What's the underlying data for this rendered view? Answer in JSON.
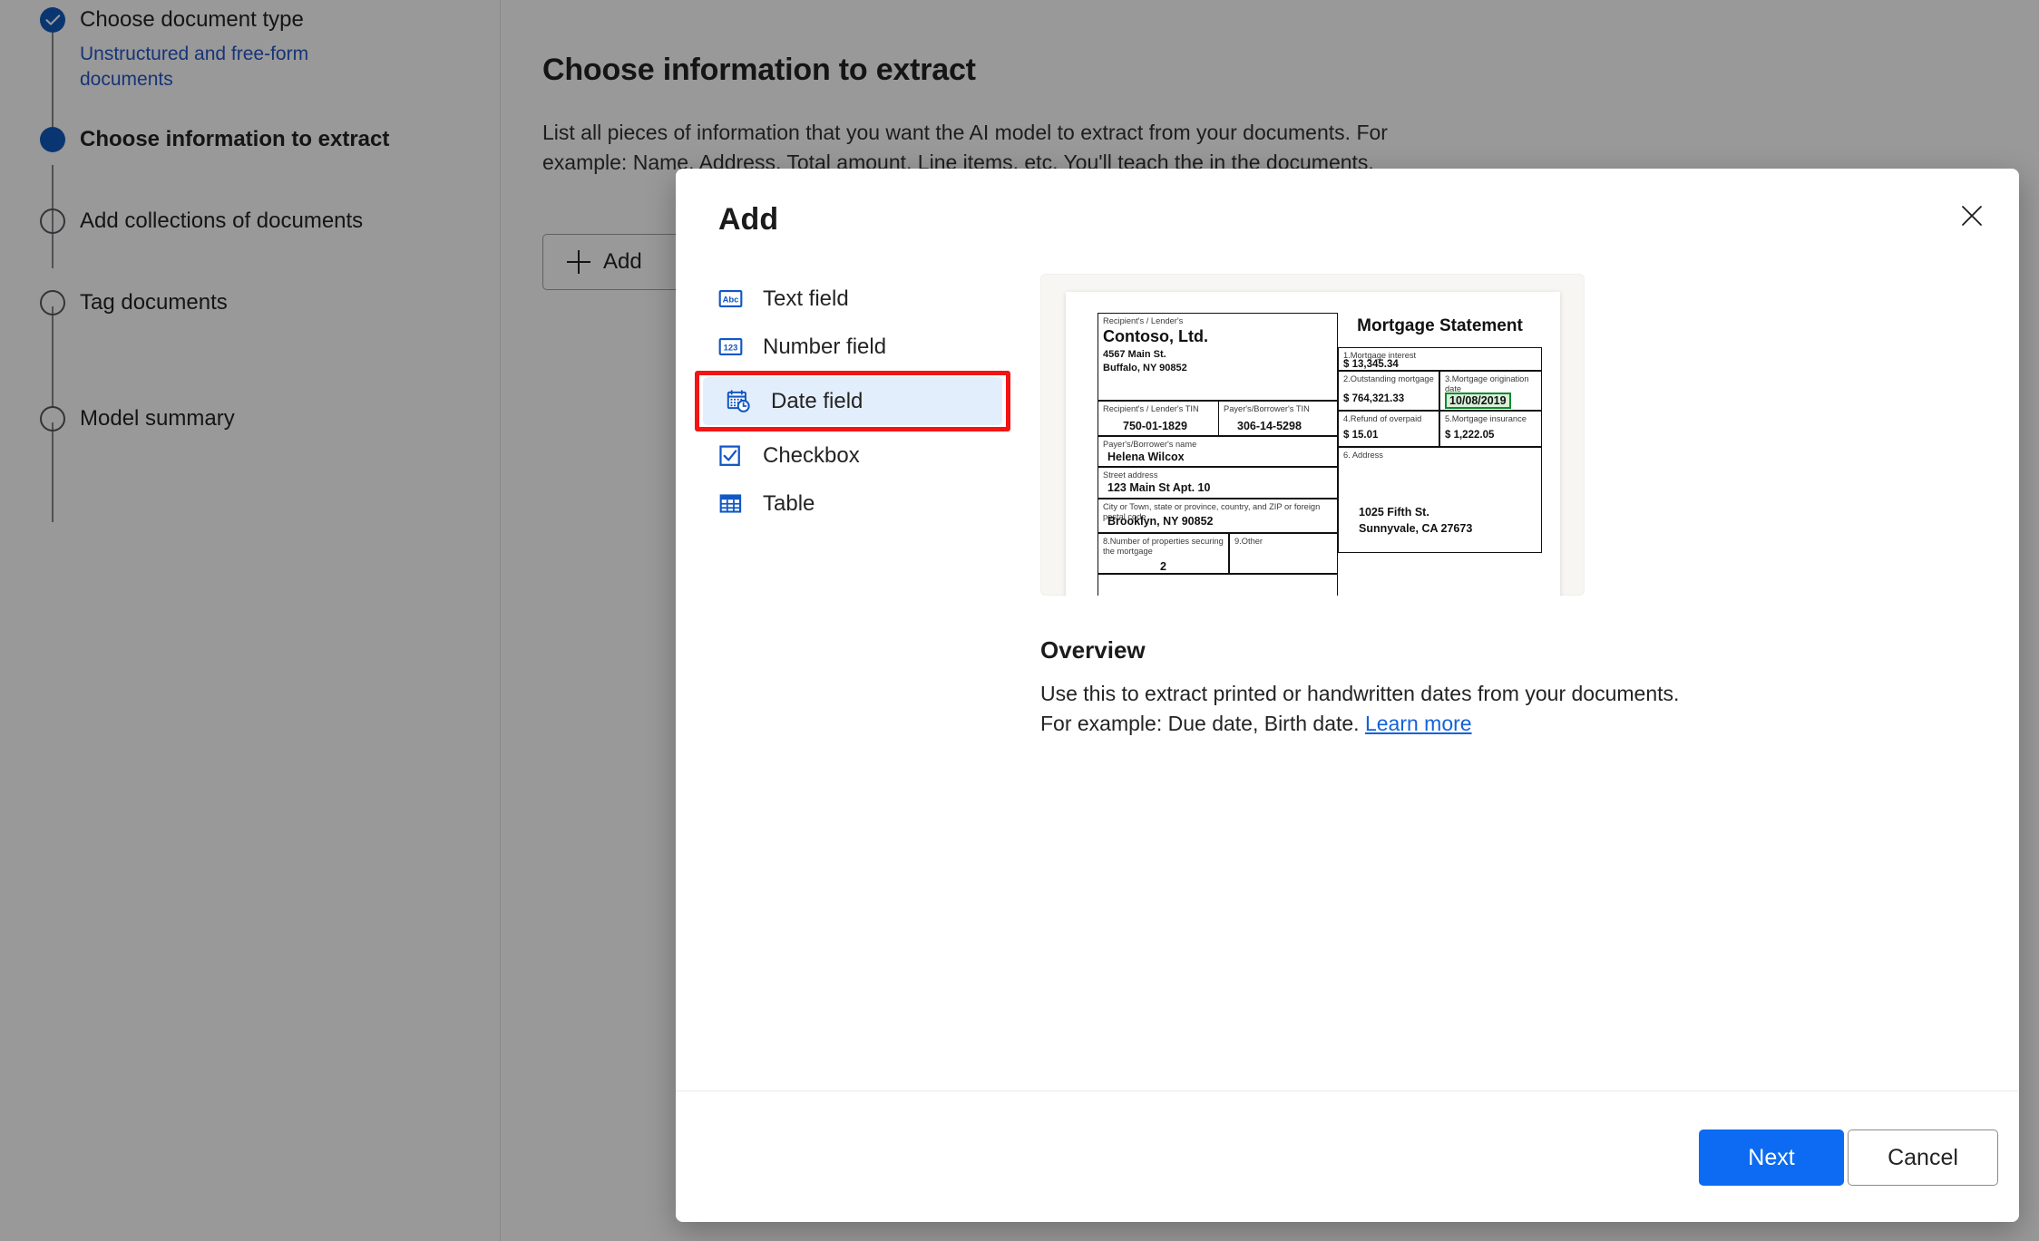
{
  "wizard": {
    "steps": [
      {
        "label": "Choose document type",
        "state": "done",
        "sublabel": "Unstructured and free-form documents"
      },
      {
        "label": "Choose information to extract",
        "state": "current",
        "sublabel": ""
      },
      {
        "label": "Add collections of documents",
        "state": "todo",
        "sublabel": ""
      },
      {
        "label": "Tag documents",
        "state": "todo",
        "sublabel": ""
      },
      {
        "label": "Model summary",
        "state": "todo",
        "sublabel": ""
      }
    ]
  },
  "page": {
    "title": "Choose information to extract",
    "description": "List all pieces of information that you want the AI model to extract from your documents. For example: Name, Address, Total amount, Line items, etc. You'll teach the in the documents.",
    "add_button": "Add",
    "add_icon": "plus-icon"
  },
  "dialog": {
    "title": "Add",
    "close_icon": "close-icon",
    "field_types": [
      {
        "label": "Text field",
        "icon": "abc-icon",
        "selected": false
      },
      {
        "label": "Number field",
        "icon": "123-icon",
        "selected": false
      },
      {
        "label": "Date field",
        "icon": "calendar-clock-icon",
        "selected": true
      },
      {
        "label": "Checkbox",
        "icon": "checkbox-icon",
        "selected": false
      },
      {
        "label": "Table",
        "icon": "table-icon",
        "selected": false
      }
    ],
    "overview": {
      "heading": "Overview",
      "text": "Use this to extract printed or handwritten dates from your documents. For example: Due date, Birth date. ",
      "link": "Learn more"
    },
    "footer": {
      "next": "Next",
      "cancel": "Cancel"
    },
    "preview_document": {
      "title": "Mortgage Statement",
      "recipient_label": "Recipient's / Lender's",
      "recipient_name": "Contoso, Ltd.",
      "recipient_street": "4567 Main St.",
      "recipient_city": "Buffalo, NY 90852",
      "recipient_tin_label": "Recipient's / Lender's TIN",
      "recipient_tin": "750-01-1829",
      "payer_tin_label": "Payer's/Borrower's TIN",
      "payer_tin": "306-14-5298",
      "payer_name_label": "Payer's/Borrower's name",
      "payer_name": "Helena Wilcox",
      "street_label": "Street address",
      "street_value": "123 Main St Apt. 10",
      "city_label": "City or Town, state or province, country, and ZIP or foreign postal code",
      "city_value": "Brooklyn, NY 90852",
      "box1_label": "1.Mortgage interest",
      "box1_value": "$  13,345.34",
      "box2_label": "2.Outstanding mortgage",
      "box2_value": "$  764,321.33",
      "box3_label": "3.Mortgage origination date",
      "box3_value": "10/08/2019",
      "box4_label": "4.Refund of overpaid",
      "box4_value": "$  15.01",
      "box5_label": "5.Mortgage insurance",
      "box5_value": "$  1,222.05",
      "box6_label": "6. Address",
      "box6_line1": "1025 Fifth St.",
      "box6_line2": "Sunnyvale, CA 27673",
      "box8_label": "8.Number of properties securing the mortgage",
      "box8_value": "2",
      "box9_label": "9.Other",
      "box9_value": ""
    }
  },
  "colors": {
    "accent": "#0c6bf2",
    "step_active": "#0f5bbd",
    "link": "#1362d8",
    "selection_outline": "#f31414",
    "selection_fill": "#e3eefc",
    "highlight_fill": "#d9f0d9",
    "highlight_border": "#0f8a2e"
  }
}
